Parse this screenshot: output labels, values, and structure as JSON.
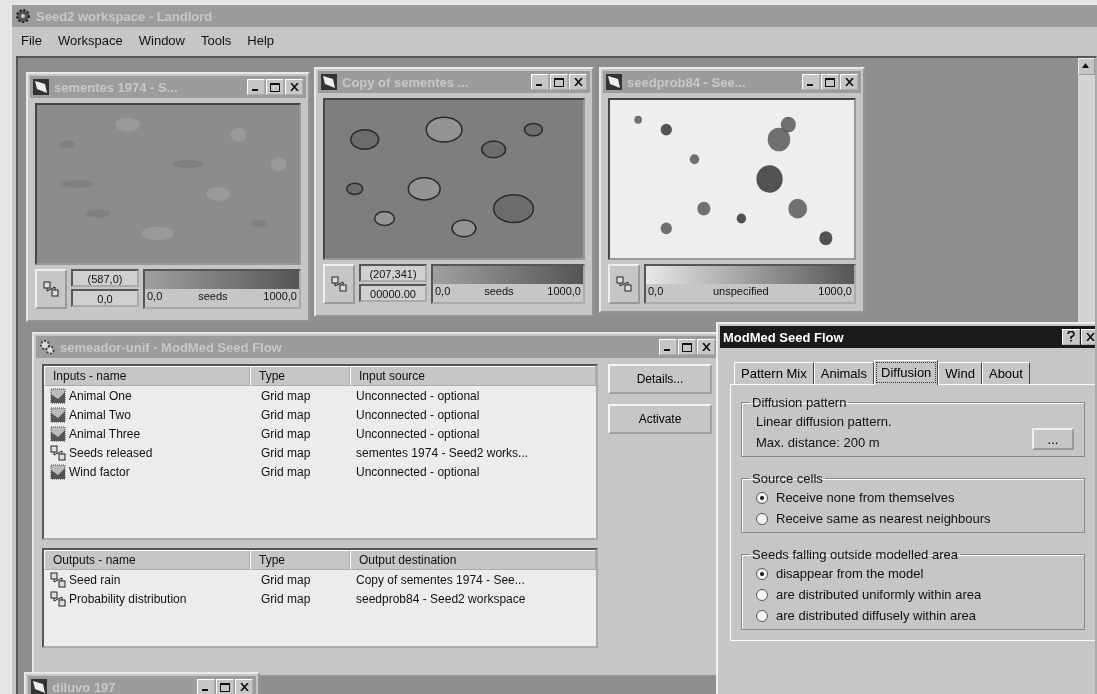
{
  "window": {
    "title": "Seed2 workspace - Landlord",
    "active": false
  },
  "menu": [
    "File",
    "Workspace",
    "Window",
    "Tools",
    "Help"
  ],
  "map_windows": [
    {
      "title": "sementes 1974 - S...",
      "active": false,
      "coords": "(587,0)",
      "value": "0,0",
      "legend": {
        "min": "0,0",
        "unit": "seeds",
        "max": "1000,0"
      }
    },
    {
      "title": "Copy of sementes ...",
      "active": false,
      "coords": "(207,341)",
      "value": "00000.00",
      "legend": {
        "min": "0,0",
        "unit": "seeds",
        "max": "1000,0"
      }
    },
    {
      "title": "seedprob84 - See...",
      "active": false,
      "legend": {
        "min": "0,0",
        "unit": "unspecified",
        "max": "1000,0"
      }
    }
  ],
  "model_window": {
    "title": "semeador-unif - ModMed Seed Flow",
    "active": false,
    "inputs": {
      "columns": [
        "Inputs - name",
        "Type",
        "Input source"
      ],
      "rows": [
        {
          "kind": "tile",
          "name": "Animal One",
          "type": "Grid map",
          "source": "Unconnected - optional"
        },
        {
          "kind": "tile",
          "name": "Animal Two",
          "type": "Grid map",
          "source": "Unconnected - optional"
        },
        {
          "kind": "tile",
          "name": "Animal Three",
          "type": "Grid map",
          "source": "Unconnected - optional"
        },
        {
          "kind": "link",
          "name": "Seeds released",
          "type": "Grid map",
          "source": "sementes 1974 - Seed2 works..."
        },
        {
          "kind": "tile",
          "name": "Wind factor",
          "type": "Grid map",
          "source": "Unconnected - optional"
        }
      ]
    },
    "outputs": {
      "columns": [
        "Outputs - name",
        "Type",
        "Output destination"
      ],
      "rows": [
        {
          "kind": "link",
          "name": "Seed rain",
          "type": "Grid map",
          "source": "Copy of sementes 1974 - See..."
        },
        {
          "kind": "link",
          "name": "Probability distribution",
          "type": "Grid map",
          "source": "seedprob84 - Seed2 workspace"
        }
      ]
    },
    "buttons": [
      "Details...",
      "Activate"
    ]
  },
  "dialog": {
    "title": "ModMed Seed Flow",
    "active": true,
    "tabs": [
      {
        "label": "Pattern Mix",
        "selected": false
      },
      {
        "label": "Animals",
        "selected": false
      },
      {
        "label": "Diffusion",
        "selected": true
      },
      {
        "label": "Wind",
        "selected": false
      },
      {
        "label": "About",
        "selected": false
      }
    ],
    "diffusion_pattern": {
      "legend": "Diffusion pattern",
      "lines": [
        "Linear diffusion pattern.",
        "Max. distance: 200 m"
      ],
      "button": "..."
    },
    "source_cells": {
      "legend": "Source cells",
      "options": [
        {
          "label": "Receive none from themselves",
          "selected": true
        },
        {
          "label": "Receive same as nearest neighbours",
          "selected": false
        }
      ]
    },
    "outside_area": {
      "legend": "Seeds falling outside modelled area",
      "options": [
        {
          "label": "disappear from the model",
          "selected": true
        },
        {
          "label": "are distributed uniformly within area",
          "selected": false
        },
        {
          "label": "are distributed diffusely within area",
          "selected": false
        }
      ]
    }
  },
  "minimized_window": {
    "title": "diluvo 197"
  }
}
